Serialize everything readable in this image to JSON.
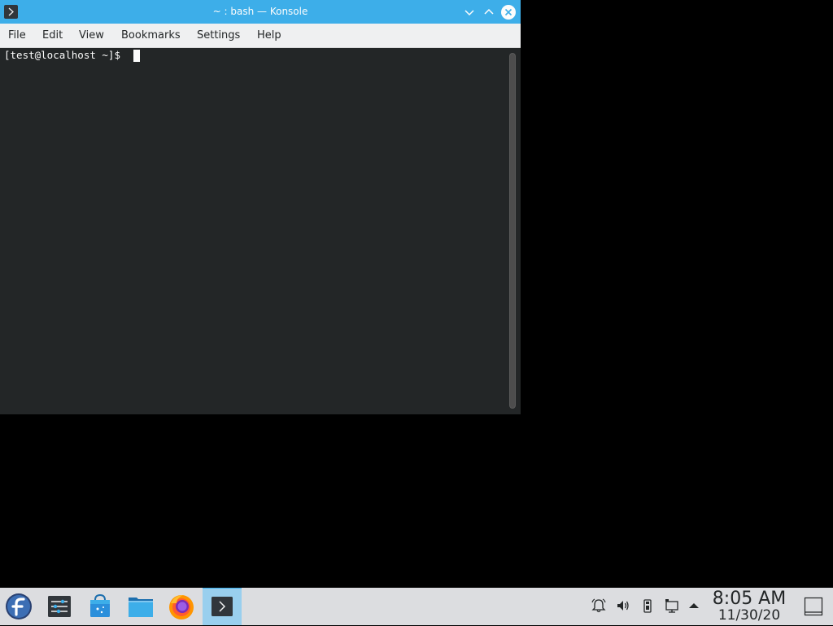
{
  "window": {
    "title": "~ : bash — Konsole"
  },
  "menubar": {
    "items": [
      "File",
      "Edit",
      "View",
      "Bookmarks",
      "Settings",
      "Help"
    ]
  },
  "terminal": {
    "prompt": "[test@localhost ~]$ "
  },
  "taskbar": {
    "apps": [
      "fedora-launcher-icon",
      "system-settings-icon",
      "discover-icon",
      "dolphin-file-manager-icon",
      "firefox-icon",
      "konsole-icon"
    ],
    "active_app": "konsole-icon"
  },
  "tray": {
    "icons": [
      "notifications-icon",
      "volume-icon",
      "removable-device-icon",
      "network-icon",
      "expand-tray-icon"
    ]
  },
  "clock": {
    "time": "8:05 AM",
    "date": "11/30/20"
  },
  "colors": {
    "titlebar": "#3daee9",
    "terminal_bg": "#232627",
    "menubar_bg": "#eff0f1",
    "taskbar_bg": "#dcdde0",
    "active_task": "#99cfee"
  }
}
